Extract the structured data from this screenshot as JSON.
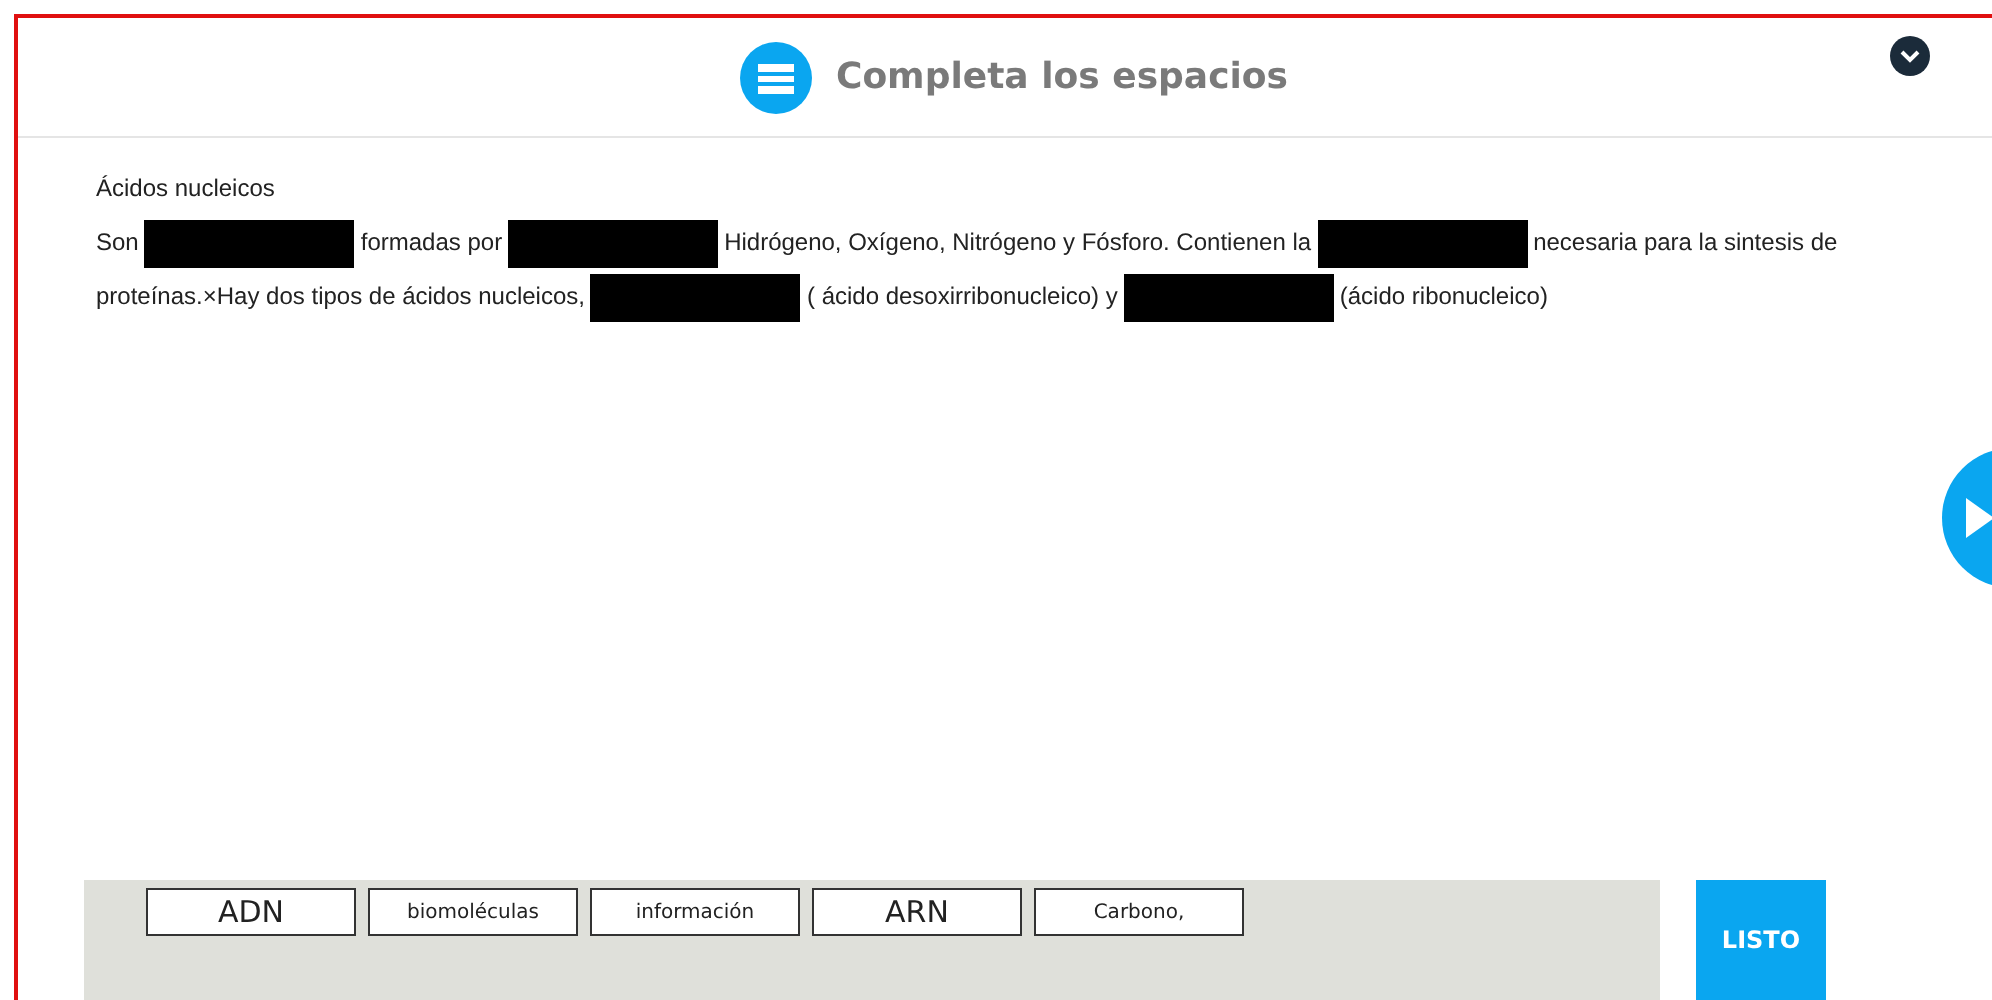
{
  "header": {
    "title": "Completa los espacios"
  },
  "exercise": {
    "heading": "Ácidos nucleicos",
    "lines": [
      [
        {
          "kind": "text",
          "text": "Son"
        },
        {
          "kind": "blank"
        },
        {
          "kind": "text",
          "text": "formadas por"
        },
        {
          "kind": "blank"
        },
        {
          "kind": "text",
          "text": "Hidrógeno, Oxígeno, Nitrógeno y Fósforo. Contienen la"
        },
        {
          "kind": "blank"
        },
        {
          "kind": "text",
          "text": "necesaria para la sintesis de"
        }
      ],
      [
        {
          "kind": "text",
          "text": "proteínas.×Hay dos tipos de ácidos nucleicos,"
        },
        {
          "kind": "blank"
        },
        {
          "kind": "text",
          "text": "( ácido desoxirribonucleico) y"
        },
        {
          "kind": "blank"
        },
        {
          "kind": "text",
          "text": "(ácido ribonucleico)"
        }
      ]
    ]
  },
  "word_bank": [
    {
      "text": "ADN",
      "kind": "large"
    },
    {
      "text": "biomoléculas",
      "kind": "small"
    },
    {
      "text": "información",
      "kind": "small"
    },
    {
      "text": "ARN",
      "kind": "large"
    },
    {
      "text": "Carbono,",
      "kind": "small"
    }
  ],
  "done_button": "LISTO"
}
